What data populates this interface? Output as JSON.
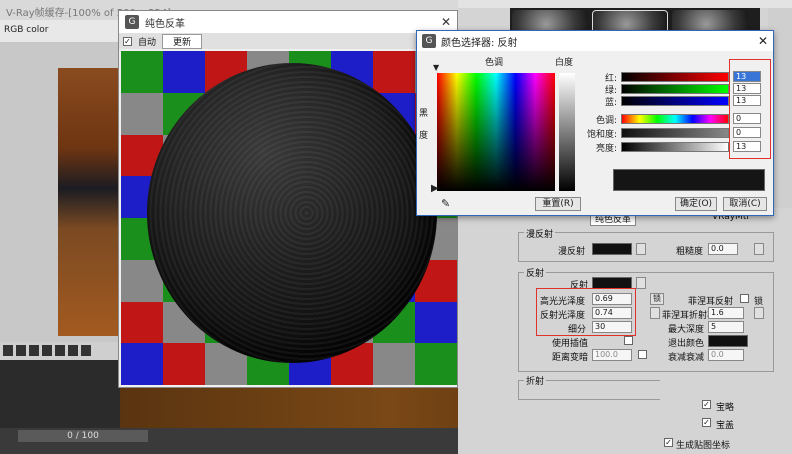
{
  "vfb": {
    "title": "V-Ray帧缓存-[100% of 500 x 324]",
    "channel": "RGB color"
  },
  "timeline": {
    "frame": "0 / 100"
  },
  "swatch_window": {
    "title": "纯色反革",
    "auto_label": "自动",
    "update_label": "更新"
  },
  "color_dialog": {
    "title": "颜色选择器: 反射",
    "hue_label": "色调",
    "whiteness_label": "白度",
    "blackness_label": "黑度",
    "channels": [
      {
        "label": "红:",
        "value": "13"
      },
      {
        "label": "绿:",
        "value": "13"
      },
      {
        "label": "蓝:",
        "value": "13"
      },
      {
        "label": "色调:",
        "value": "0"
      },
      {
        "label": "饱和度:",
        "value": "0"
      },
      {
        "label": "亮度:",
        "value": "13"
      }
    ],
    "reset_label": "重置(R)",
    "ok_label": "确定(O)",
    "cancel_label": "取消(C)"
  },
  "material": {
    "diffuse_group": "漫反射",
    "diffuse_label": "漫反射",
    "roughness_label": "粗糙度",
    "roughness_value": "0.0",
    "reflect_group": "反射",
    "reflect_label": "反射",
    "hilight_gloss_label": "高光光泽度",
    "hilight_gloss_value": "0.69",
    "lock_label": "锁",
    "fresnel_label": "菲涅耳反射",
    "fresnel_ior_label": "菲涅耳折射率",
    "fresnel_ior_value": "1.6",
    "refl_gloss_label": "反射光泽度",
    "refl_gloss_value": "0.74",
    "max_depth_label": "最大深度",
    "max_depth_value": "5",
    "subdivs_label": "细分",
    "subdivs_value": "30",
    "use_interp_label": "使用插值",
    "exit_color_label": "退出颜色",
    "dim_dist_label": "距离变暗",
    "dim_dist_value": "100.0",
    "dim_falloff_label": "衰减衰减",
    "dim_falloff_value": "0.0",
    "refract_group": "折射",
    "material_name": "纯色反革",
    "material_type": "VRayMtl"
  },
  "bottom_options": {
    "opt1": "宝略",
    "opt2": "宝盖",
    "opt3": "生成贴图坐标"
  }
}
